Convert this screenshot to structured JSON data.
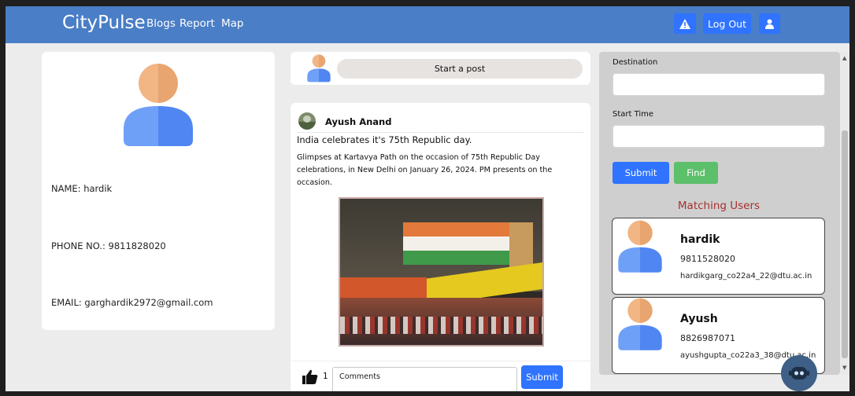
{
  "nav": {
    "brand": "CityPulse",
    "links": [
      "Blogs",
      "Report",
      "Map"
    ],
    "logout_label": "Log Out",
    "alert_icon": "warning-icon",
    "user_icon": "user-icon"
  },
  "profile": {
    "name_line": "NAME: hardik",
    "phone_line": "PHONE NO.: 9811828020",
    "email_line": "EMAIL: garghardik2972@gmail.com"
  },
  "composer": {
    "start_post_label": "Start a post"
  },
  "post": {
    "author": "Ayush Anand",
    "title": "India celebrates it's 75th Republic day.",
    "body": "Glimpses at Kartavya Path on the occasion of 75th Republic Day celebrations, in New Delhi on January 26, 2024. PM presents on the occasion.",
    "like_count": "1",
    "comment_placeholder": "Comments",
    "submit_label": "Submit"
  },
  "sidebar": {
    "destination_label": "Destination",
    "start_time_label": "Start Time",
    "submit_label": "Submit",
    "find_label": "Find",
    "matching_title": "Matching Users",
    "users": [
      {
        "name": "hardik",
        "phone": "9811528020",
        "email": "hardikgarg_co22a4_22@dtu.ac.in"
      },
      {
        "name": "Ayush",
        "phone": "8826987071",
        "email": "ayushgupta_co22a3_38@dtu.ac.in"
      }
    ]
  },
  "colors": {
    "nav": "#4a7ec6",
    "primary_button": "#2f73ff",
    "find_button": "#5cbf6a",
    "matching_title": "#a82f2f",
    "avatar_head": "#f2b584",
    "avatar_body": "#5d8ff5"
  }
}
